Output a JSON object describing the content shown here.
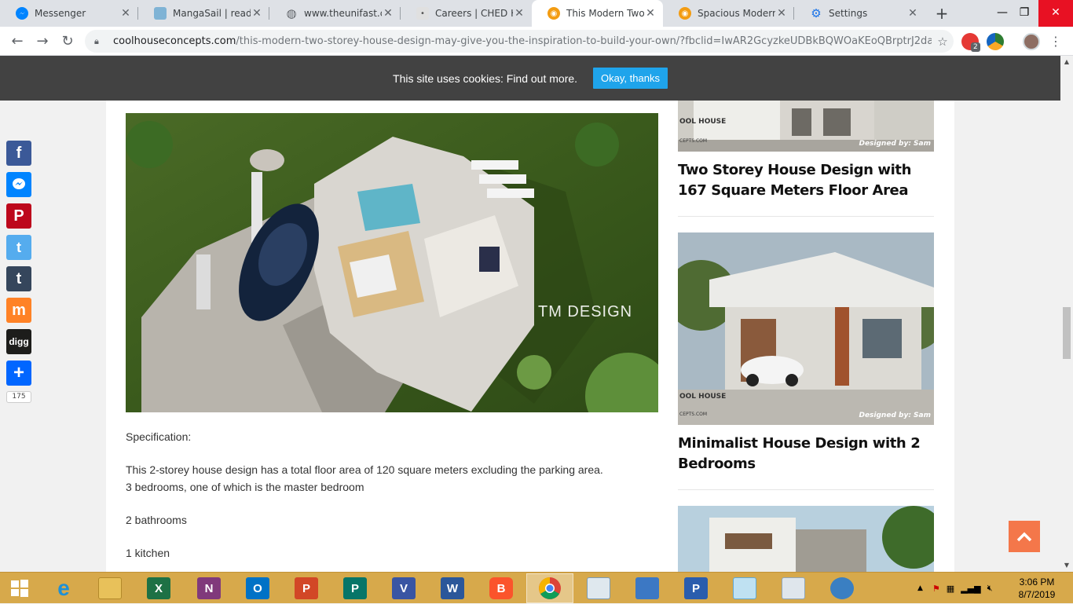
{
  "browser": {
    "tabs": [
      {
        "label": "Messenger",
        "icon": "messenger-icon",
        "color": "#0084ff"
      },
      {
        "label": "MangaSail | read th",
        "icon": "mangasail-icon",
        "color": "#7fb3d5"
      },
      {
        "label": "www.theunifast.com",
        "icon": "globe-icon",
        "color": "#5f6368"
      },
      {
        "label": "Careers | CHED K to",
        "icon": "ched-icon",
        "color": "#9e9e9e"
      },
      {
        "label": "This Modern Two-s",
        "icon": "coolhouse-icon",
        "color": "#f39c12"
      },
      {
        "label": "Spacious Modern F",
        "icon": "coolhouse-icon",
        "color": "#f39c12"
      },
      {
        "label": "Settings",
        "icon": "gear-icon",
        "color": "#1a73e8"
      }
    ],
    "url_host": "coolhouseconcepts.com",
    "url_path": "/this-modern-two-storey-house-design-may-give-you-the-inspiration-to-build-your-own/?fbclid=IwAR2GcyzkeUDBkBQWOaKEoQBrptrJ2da...",
    "extension_badge": "2"
  },
  "cookie": {
    "message": "This site uses cookies: Find out more.",
    "button": "Okay, thanks"
  },
  "article": {
    "spec_heading": "Specification:",
    "line1": "This 2-storey house design has a total floor area of 120 square meters excluding the parking area.",
    "line2": "3 bedrooms, one of which is the master bedroom",
    "line3": "2 bathrooms",
    "line4": "1 kitchen",
    "watermark": "TM DESIGN"
  },
  "sidebar": {
    "post1_title": "Two Storey House Design with 167 Square Meters Floor Area",
    "post2_title": "Minimalist House Design with 2 Bedrooms",
    "logo_text": "OOL HOUSE",
    "logo_sub": "CEPTS.COM",
    "designed_by": "Designed by: Sam"
  },
  "share": {
    "count": "175",
    "buttons": [
      {
        "name": "facebook",
        "glyph": "f",
        "color": "#3b5998"
      },
      {
        "name": "messenger",
        "glyph": "m",
        "color": "#0084ff"
      },
      {
        "name": "pinterest",
        "glyph": "P",
        "color": "#bd081c"
      },
      {
        "name": "twitter",
        "glyph": "t",
        "color": "#55acee"
      },
      {
        "name": "tumblr",
        "glyph": "t",
        "color": "#35465c"
      },
      {
        "name": "mix",
        "glyph": "m",
        "color": "#ff8226"
      },
      {
        "name": "digg",
        "glyph": "digg",
        "color": "#1d1d1b"
      },
      {
        "name": "share-more",
        "glyph": "+",
        "color": "#0166ff"
      }
    ]
  },
  "taskbar": {
    "apps": [
      {
        "name": "ie",
        "glyph": "e",
        "color": "#1e90d6"
      },
      {
        "name": "file-explorer",
        "glyph": "",
        "color": "#e8c15a"
      },
      {
        "name": "excel",
        "glyph": "X",
        "color": "#1e7145"
      },
      {
        "name": "onenote",
        "glyph": "N",
        "color": "#80397b"
      },
      {
        "name": "outlook",
        "glyph": "O",
        "color": "#0072c6"
      },
      {
        "name": "powerpoint",
        "glyph": "P",
        "color": "#d24726"
      },
      {
        "name": "publisher",
        "glyph": "P",
        "color": "#077568"
      },
      {
        "name": "visio",
        "glyph": "V",
        "color": "#3955a3"
      },
      {
        "name": "word",
        "glyph": "W",
        "color": "#2b579a"
      },
      {
        "name": "brave",
        "glyph": "B",
        "color": "#fb542b"
      },
      {
        "name": "chrome",
        "glyph": "",
        "color": "#4285f4"
      },
      {
        "name": "performance-monitor",
        "glyph": "",
        "color": "#7a9bb5"
      },
      {
        "name": "remote-desktop",
        "glyph": "",
        "color": "#3c78c4"
      },
      {
        "name": "parking-app",
        "glyph": "P",
        "color": "#2a5dad"
      },
      {
        "name": "notepad",
        "glyph": "",
        "color": "#5fa8d3"
      },
      {
        "name": "calculator",
        "glyph": "",
        "color": "#8fa6b8"
      },
      {
        "name": "dolphin-app",
        "glyph": "",
        "color": "#3a7fc2"
      }
    ],
    "time": "3:06 PM",
    "date": "8/7/2019"
  }
}
